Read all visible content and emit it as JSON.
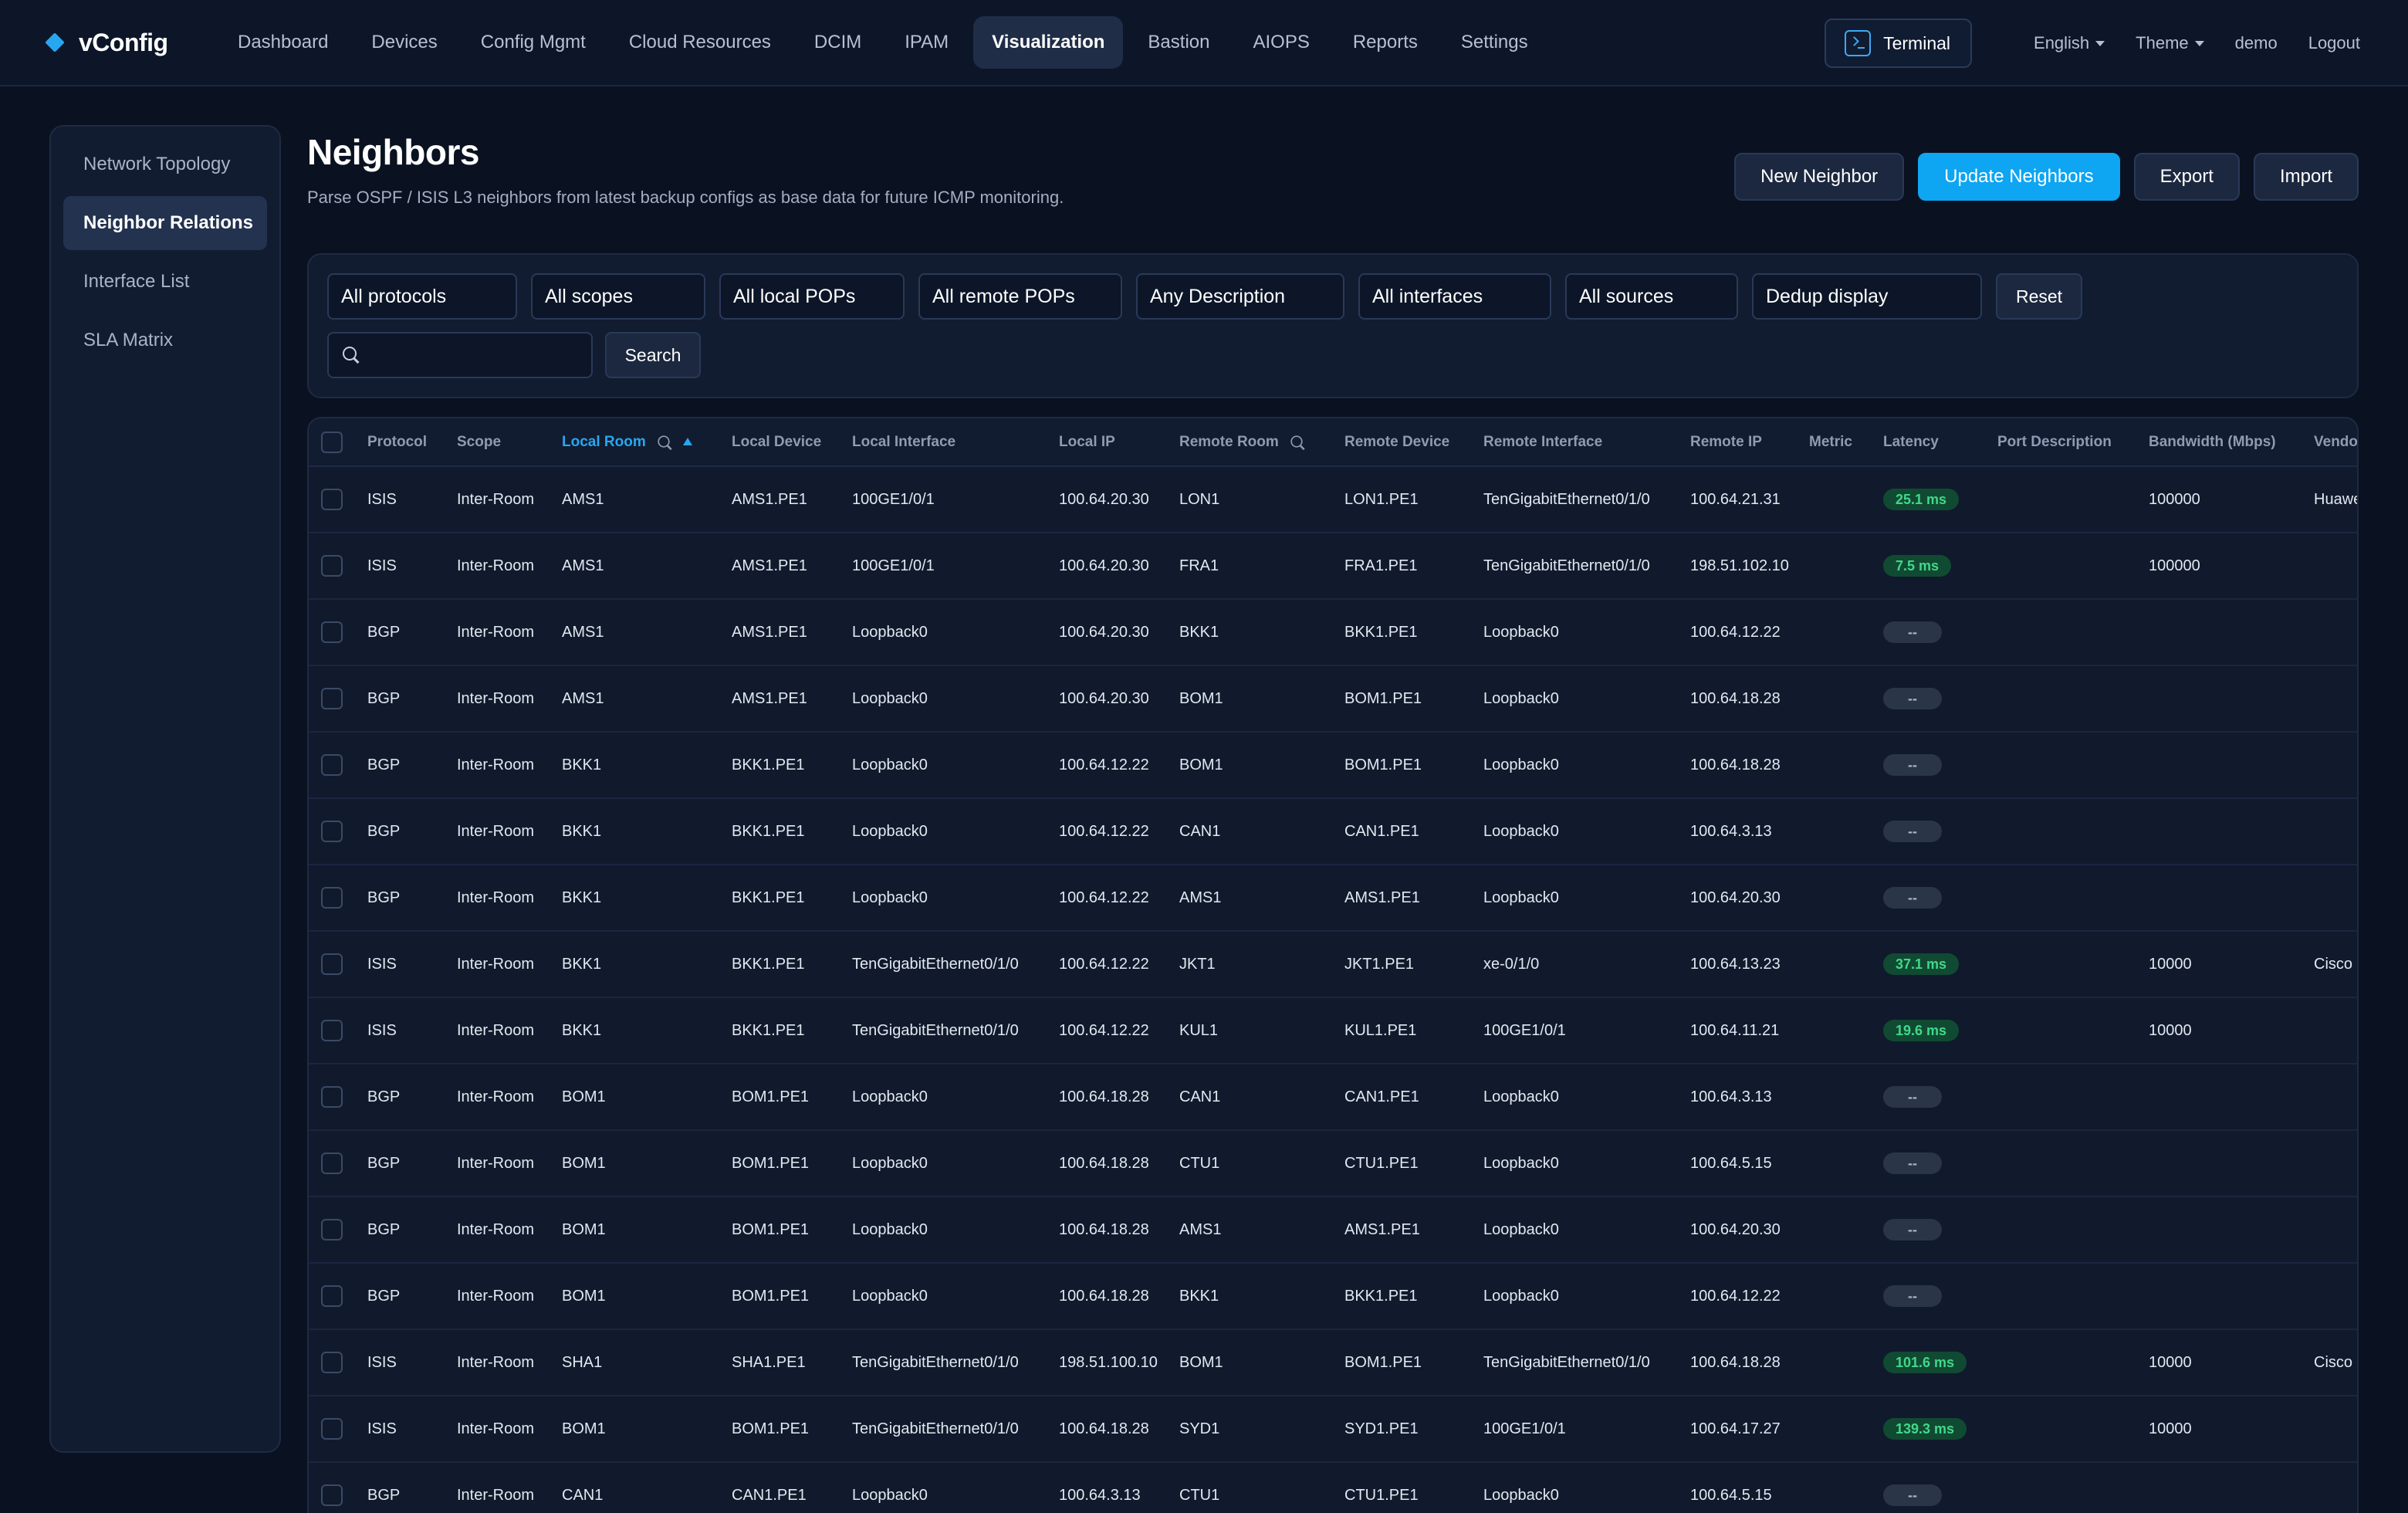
{
  "brand": "vConfig",
  "nav": [
    "Dashboard",
    "Devices",
    "Config Mgmt",
    "Cloud Resources",
    "DCIM",
    "IPAM",
    "Visualization",
    "Bastion",
    "AIOPS",
    "Reports",
    "Settings"
  ],
  "nav_active": "Visualization",
  "top_right": {
    "terminal": "Terminal",
    "language": "English",
    "theme": "Theme",
    "user": "demo",
    "logout": "Logout"
  },
  "sidebar": [
    "Network Topology",
    "Neighbor Relations",
    "Interface List",
    "SLA Matrix"
  ],
  "sidebar_active": "Neighbor Relations",
  "page": {
    "title": "Neighbors",
    "subtitle": "Parse OSPF / ISIS L3 neighbors from latest backup configs as base data for future ICMP monitoring."
  },
  "actions": {
    "new": "New Neighbor",
    "update": "Update Neighbors",
    "export": "Export",
    "import": "Import"
  },
  "filters": {
    "protocol": "All protocols",
    "scope": "All scopes",
    "local_pop": "All local POPs",
    "remote_pop": "All remote POPs",
    "description": "Any Description",
    "interfaces": "All interfaces",
    "sources": "All sources",
    "dedup": "Dedup display",
    "reset": "Reset",
    "search_value": "",
    "search_button": "Search"
  },
  "columns": [
    "Protocol",
    "Scope",
    "Local Room",
    "Local Device",
    "Local Interface",
    "Local IP",
    "Remote Room",
    "Remote Device",
    "Remote Interface",
    "Remote IP",
    "Metric",
    "Latency",
    "Port Description",
    "Bandwidth (Mbps)",
    "Vendor"
  ],
  "rows": [
    {
      "protocol": "ISIS",
      "scope": "Inter-Room",
      "local_room": "AMS1",
      "local_device": "AMS1.PE1",
      "local_intf": "100GE1/0/1",
      "local_ip": "100.64.20.30",
      "remote_room": "LON1",
      "remote_device": "LON1.PE1",
      "remote_intf": "TenGigabitEthernet0/1/0",
      "remote_ip": "100.64.21.31",
      "metric": "",
      "latency": "25.1 ms",
      "port_desc": "",
      "bandwidth": "100000",
      "vendor": "Huawei"
    },
    {
      "protocol": "ISIS",
      "scope": "Inter-Room",
      "local_room": "AMS1",
      "local_device": "AMS1.PE1",
      "local_intf": "100GE1/0/1",
      "local_ip": "100.64.20.30",
      "remote_room": "FRA1",
      "remote_device": "FRA1.PE1",
      "remote_intf": "TenGigabitEthernet0/1/0",
      "remote_ip": "198.51.102.10",
      "metric": "",
      "latency": "7.5 ms",
      "port_desc": "",
      "bandwidth": "100000",
      "vendor": ""
    },
    {
      "protocol": "BGP",
      "scope": "Inter-Room",
      "local_room": "AMS1",
      "local_device": "AMS1.PE1",
      "local_intf": "Loopback0",
      "local_ip": "100.64.20.30",
      "remote_room": "BKK1",
      "remote_device": "BKK1.PE1",
      "remote_intf": "Loopback0",
      "remote_ip": "100.64.12.22",
      "metric": "",
      "latency": "--",
      "port_desc": "",
      "bandwidth": "",
      "vendor": ""
    },
    {
      "protocol": "BGP",
      "scope": "Inter-Room",
      "local_room": "AMS1",
      "local_device": "AMS1.PE1",
      "local_intf": "Loopback0",
      "local_ip": "100.64.20.30",
      "remote_room": "BOM1",
      "remote_device": "BOM1.PE1",
      "remote_intf": "Loopback0",
      "remote_ip": "100.64.18.28",
      "metric": "",
      "latency": "--",
      "port_desc": "",
      "bandwidth": "",
      "vendor": ""
    },
    {
      "protocol": "BGP",
      "scope": "Inter-Room",
      "local_room": "BKK1",
      "local_device": "BKK1.PE1",
      "local_intf": "Loopback0",
      "local_ip": "100.64.12.22",
      "remote_room": "BOM1",
      "remote_device": "BOM1.PE1",
      "remote_intf": "Loopback0",
      "remote_ip": "100.64.18.28",
      "metric": "",
      "latency": "--",
      "port_desc": "",
      "bandwidth": "",
      "vendor": ""
    },
    {
      "protocol": "BGP",
      "scope": "Inter-Room",
      "local_room": "BKK1",
      "local_device": "BKK1.PE1",
      "local_intf": "Loopback0",
      "local_ip": "100.64.12.22",
      "remote_room": "CAN1",
      "remote_device": "CAN1.PE1",
      "remote_intf": "Loopback0",
      "remote_ip": "100.64.3.13",
      "metric": "",
      "latency": "--",
      "port_desc": "",
      "bandwidth": "",
      "vendor": ""
    },
    {
      "protocol": "BGP",
      "scope": "Inter-Room",
      "local_room": "BKK1",
      "local_device": "BKK1.PE1",
      "local_intf": "Loopback0",
      "local_ip": "100.64.12.22",
      "remote_room": "AMS1",
      "remote_device": "AMS1.PE1",
      "remote_intf": "Loopback0",
      "remote_ip": "100.64.20.30",
      "metric": "",
      "latency": "--",
      "port_desc": "",
      "bandwidth": "",
      "vendor": ""
    },
    {
      "protocol": "ISIS",
      "scope": "Inter-Room",
      "local_room": "BKK1",
      "local_device": "BKK1.PE1",
      "local_intf": "TenGigabitEthernet0/1/0",
      "local_ip": "100.64.12.22",
      "remote_room": "JKT1",
      "remote_device": "JKT1.PE1",
      "remote_intf": "xe-0/1/0",
      "remote_ip": "100.64.13.23",
      "metric": "",
      "latency": "37.1 ms",
      "port_desc": "",
      "bandwidth": "10000",
      "vendor": "Cisco"
    },
    {
      "protocol": "ISIS",
      "scope": "Inter-Room",
      "local_room": "BKK1",
      "local_device": "BKK1.PE1",
      "local_intf": "TenGigabitEthernet0/1/0",
      "local_ip": "100.64.12.22",
      "remote_room": "KUL1",
      "remote_device": "KUL1.PE1",
      "remote_intf": "100GE1/0/1",
      "remote_ip": "100.64.11.21",
      "metric": "",
      "latency": "19.6 ms",
      "port_desc": "",
      "bandwidth": "10000",
      "vendor": ""
    },
    {
      "protocol": "BGP",
      "scope": "Inter-Room",
      "local_room": "BOM1",
      "local_device": "BOM1.PE1",
      "local_intf": "Loopback0",
      "local_ip": "100.64.18.28",
      "remote_room": "CAN1",
      "remote_device": "CAN1.PE1",
      "remote_intf": "Loopback0",
      "remote_ip": "100.64.3.13",
      "metric": "",
      "latency": "--",
      "port_desc": "",
      "bandwidth": "",
      "vendor": ""
    },
    {
      "protocol": "BGP",
      "scope": "Inter-Room",
      "local_room": "BOM1",
      "local_device": "BOM1.PE1",
      "local_intf": "Loopback0",
      "local_ip": "100.64.18.28",
      "remote_room": "CTU1",
      "remote_device": "CTU1.PE1",
      "remote_intf": "Loopback0",
      "remote_ip": "100.64.5.15",
      "metric": "",
      "latency": "--",
      "port_desc": "",
      "bandwidth": "",
      "vendor": ""
    },
    {
      "protocol": "BGP",
      "scope": "Inter-Room",
      "local_room": "BOM1",
      "local_device": "BOM1.PE1",
      "local_intf": "Loopback0",
      "local_ip": "100.64.18.28",
      "remote_room": "AMS1",
      "remote_device": "AMS1.PE1",
      "remote_intf": "Loopback0",
      "remote_ip": "100.64.20.30",
      "metric": "",
      "latency": "--",
      "port_desc": "",
      "bandwidth": "",
      "vendor": ""
    },
    {
      "protocol": "BGP",
      "scope": "Inter-Room",
      "local_room": "BOM1",
      "local_device": "BOM1.PE1",
      "local_intf": "Loopback0",
      "local_ip": "100.64.18.28",
      "remote_room": "BKK1",
      "remote_device": "BKK1.PE1",
      "remote_intf": "Loopback0",
      "remote_ip": "100.64.12.22",
      "metric": "",
      "latency": "--",
      "port_desc": "",
      "bandwidth": "",
      "vendor": ""
    },
    {
      "protocol": "ISIS",
      "scope": "Inter-Room",
      "local_room": "SHA1",
      "local_device": "SHA1.PE1",
      "local_intf": "TenGigabitEthernet0/1/0",
      "local_ip": "198.51.100.10",
      "remote_room": "BOM1",
      "remote_device": "BOM1.PE1",
      "remote_intf": "TenGigabitEthernet0/1/0",
      "remote_ip": "100.64.18.28",
      "metric": "",
      "latency": "101.6 ms",
      "port_desc": "",
      "bandwidth": "10000",
      "vendor": "Cisco"
    },
    {
      "protocol": "ISIS",
      "scope": "Inter-Room",
      "local_room": "BOM1",
      "local_device": "BOM1.PE1",
      "local_intf": "TenGigabitEthernet0/1/0",
      "local_ip": "100.64.18.28",
      "remote_room": "SYD1",
      "remote_device": "SYD1.PE1",
      "remote_intf": "100GE1/0/1",
      "remote_ip": "100.64.17.27",
      "metric": "",
      "latency": "139.3 ms",
      "port_desc": "",
      "bandwidth": "10000",
      "vendor": ""
    },
    {
      "protocol": "BGP",
      "scope": "Inter-Room",
      "local_room": "CAN1",
      "local_device": "CAN1.PE1",
      "local_intf": "Loopback0",
      "local_ip": "100.64.3.13",
      "remote_room": "CTU1",
      "remote_device": "CTU1.PE1",
      "remote_intf": "Loopback0",
      "remote_ip": "100.64.5.15",
      "metric": "",
      "latency": "--",
      "port_desc": "",
      "bandwidth": "",
      "vendor": ""
    }
  ],
  "colors": {
    "accent": "#0ea5f2",
    "latency_ok_bg": "#114a32",
    "latency_ok_text": "#40d88a",
    "latency_na_bg": "#2a3548"
  },
  "icons": {
    "brand": "diamond-icon",
    "terminal": "terminal-icon",
    "search": "search-icon",
    "sort": "sort-ascending-icon"
  }
}
